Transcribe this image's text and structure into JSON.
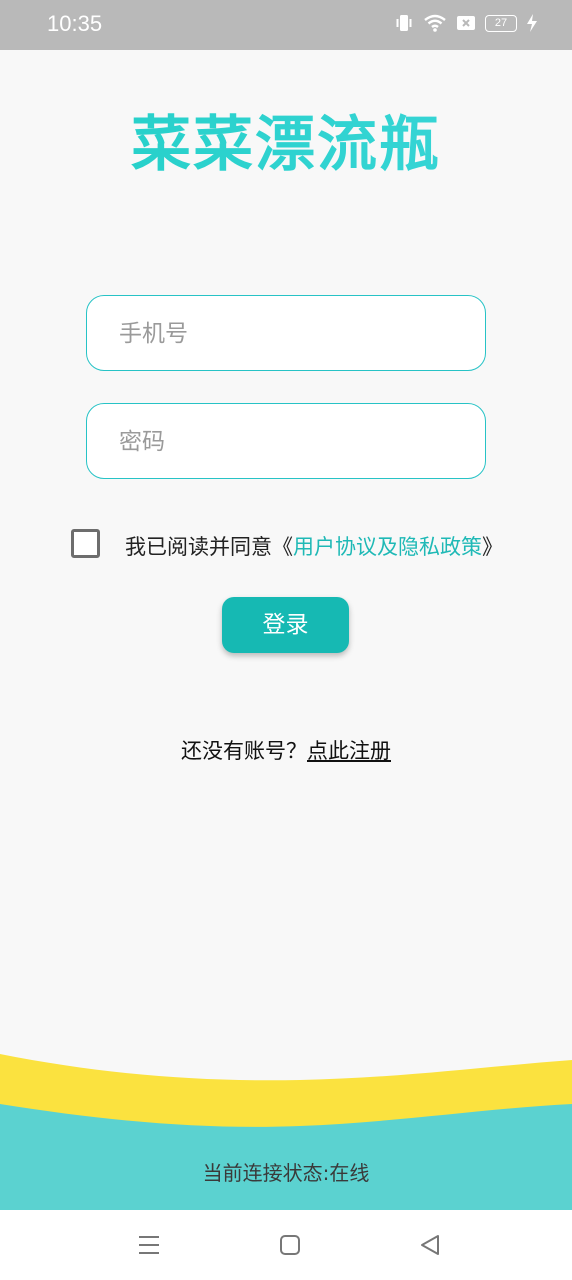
{
  "status_bar": {
    "time": "10:35",
    "battery_level": "27"
  },
  "app": {
    "title": "菜菜漂流瓶"
  },
  "login_form": {
    "phone_placeholder": "手机号",
    "password_placeholder": "密码",
    "agreement_prefix": "我已阅读并同意《",
    "agreement_link": "用户协议及隐私政策",
    "agreement_suffix": "》",
    "agreement_checked": false,
    "login_button": "登录"
  },
  "register": {
    "prompt": "还没有账号？",
    "link": "点此注册"
  },
  "footer": {
    "connection_status": "当前连接状态:在线"
  },
  "colors": {
    "accent": "#16b9b3",
    "title": "#2bcfcf",
    "wave_yellow": "#fbe23f",
    "wave_teal": "#5bd2d0",
    "status_bar": "#b9b9b9"
  },
  "icons": {
    "status": [
      "vibrate-icon",
      "wifi-icon",
      "sim-off-icon",
      "battery-icon",
      "charging-icon"
    ],
    "nav": [
      "menu-icon",
      "home-icon",
      "back-icon"
    ]
  }
}
